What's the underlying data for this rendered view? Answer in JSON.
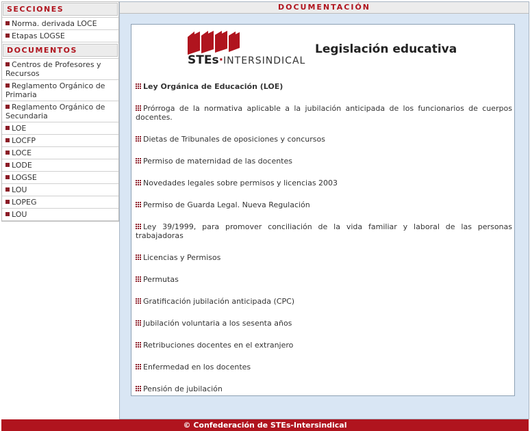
{
  "sidebar": {
    "sections_title": "SECCIONES",
    "sections": [
      {
        "label": "Norma. derivada LOCE"
      },
      {
        "label": "Etapas LOGSE"
      }
    ],
    "documents_title": "DOCUMENTOS",
    "documents": [
      {
        "label": "Centros de Profesores y Recursos"
      },
      {
        "label": "Reglamento Orgánico de Primaria"
      },
      {
        "label": "Reglamento Orgánico de Secundaria"
      },
      {
        "label": "LOE"
      },
      {
        "label": "LOCFP"
      },
      {
        "label": "LOCE"
      },
      {
        "label": "LODE"
      },
      {
        "label": "LOGSE"
      },
      {
        "label": "LOU"
      },
      {
        "label": "LOPEG"
      },
      {
        "label": "LOU"
      }
    ]
  },
  "main": {
    "header": "DOCUMENTACIÓN",
    "logo": {
      "ste": "STEs",
      "inter": "INTERSINDICAL"
    },
    "title": "Legislación educativa",
    "items": [
      {
        "label": "Ley Orgánica de Educación (LOE)",
        "bold": true
      },
      {
        "label": "Prórroga de la normativa aplicable a la jubilación anticipada de los funcionarios de cuerpos docentes."
      },
      {
        "label": "Dietas de Tribunales de oposiciones y concursos"
      },
      {
        "label": "Permiso de maternidad de las docentes"
      },
      {
        "label": "Novedades legales sobre permisos y licencias 2003"
      },
      {
        "label": "Permiso de Guarda Legal. Nueva Regulación"
      },
      {
        "label": "Ley 39/1999, para promover conciliación de la vida familiar y laboral de las personas trabajadoras"
      },
      {
        "label": "Licencias y Permisos"
      },
      {
        "label": "Permutas"
      },
      {
        "label": "Gratificación jubilación anticipada (CPC)"
      },
      {
        "label": "Jubilación voluntaria a los sesenta años"
      },
      {
        "label": "Retribuciones docentes en el extranjero"
      },
      {
        "label": "Enfermedad en los docentes"
      },
      {
        "label": "Pensión de jubilación"
      }
    ]
  },
  "footer": {
    "text": "© Confederación de STEs-Intersindical"
  },
  "colors": {
    "brand_red": "#b0141e",
    "panel_blue": "#d9e6f4",
    "bullet": "#8b1b26"
  }
}
